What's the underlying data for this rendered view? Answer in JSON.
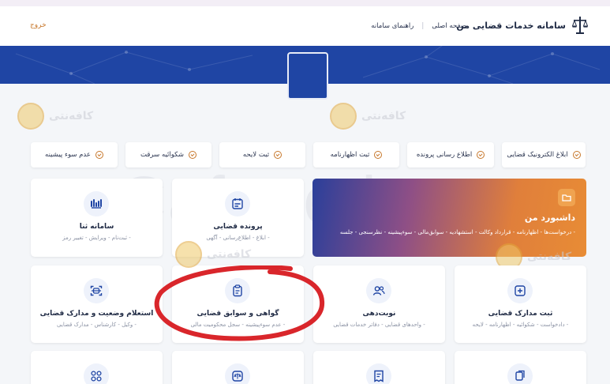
{
  "header": {
    "brand": "سامانه خدمات قضایی من",
    "nav": [
      "صفحه اصلی",
      "راهنمای سامانه"
    ],
    "logout": "خروج"
  },
  "watermark": {
    "text": "کافه‌نتی",
    "big": "Cafeneti.com"
  },
  "quick_links": [
    "ابلاغ الکترونیک قضایی",
    "اطلاع رسانی پرونده",
    "ثبت اظهارنامه",
    "ثبت لایحه",
    "شکوائیه سرقت",
    "عدم سوء پیشینه"
  ],
  "dashboard": {
    "title": "داشبورد من",
    "subtitle": "- درخواست‌ها  - اظهارنامه  - قرارداد وکالت  - استشهادیه  - سوابق‌مالی  - سوءپیشینه  - نظرسنجی  - جلسه"
  },
  "cards": {
    "sana": {
      "title": "سامانه ثنا",
      "sub": "- ثبت‌نام  - ویرایش  - تغییر رمز"
    },
    "case": {
      "title": "پرونده قضایی",
      "sub": "- ابلاغ  - اطلاع‌رسانی  - آگهی"
    },
    "inquiry": {
      "title": "استعلام وضعیت و مدارک قضایی",
      "sub": "- وکیل  - کارشناس  - مدارک قضایی"
    },
    "certificate": {
      "title": "گواهی و سوابق قضایی",
      "sub": "- عدم سوءپیشینه  - سجل محکومیت مالی"
    },
    "turn": {
      "title": "نوبت‌دهی",
      "sub": "- واحدهای قضایی  - دفاتر خدمات قضایی"
    },
    "register": {
      "title": "ثبت مدارک قضایی",
      "sub": "- دادخواست  - شکوائیه  - اظهارنامه  - لایحه"
    }
  },
  "icons": {
    "logo": "scales-icon",
    "dashboard": "folder-icon",
    "sana": "sana-logo-icon",
    "case": "calendar-icon",
    "inquiry": "scan-icon",
    "certificate": "clipboard-icon",
    "turn": "users-icon",
    "register": "add-document-icon"
  },
  "colors": {
    "primary": "#1f45a4",
    "accent": "#c7772b",
    "annotation": "#d9262b"
  }
}
